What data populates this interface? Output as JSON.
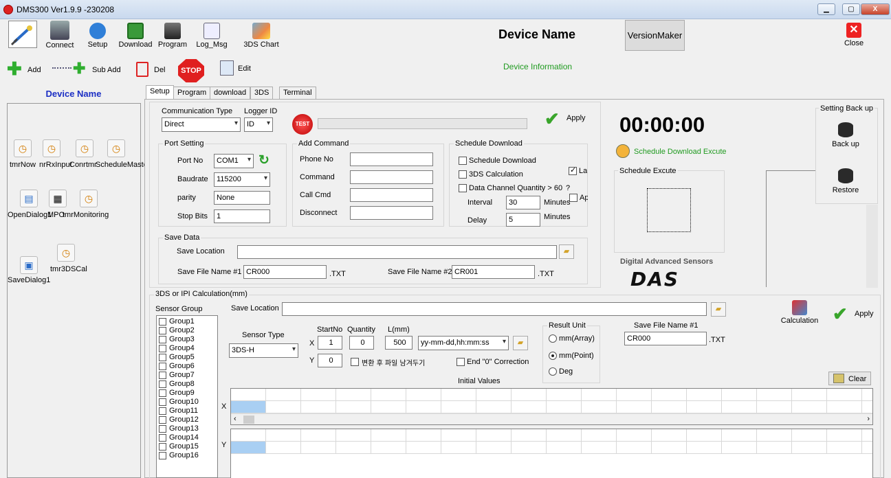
{
  "window": {
    "title": "DMS300 Ver1.9.9 -230208",
    "minimize": "▁",
    "maximize": "▢",
    "close": "X"
  },
  "toolbar": {
    "connect": "Connect",
    "setup": "Setup",
    "download": "Download",
    "program": "Program",
    "log_msg": "Log_Msg",
    "chart_3ds": "3DS Chart",
    "close": "Close",
    "add": "Add",
    "sub_add": "Sub Add",
    "del": "Del",
    "edit": "Edit"
  },
  "header": {
    "device_name": "Device Name",
    "version_maker": "VersionMaker",
    "device_info": "Device Information"
  },
  "left_panel": {
    "title": "Device Name",
    "components": [
      {
        "label": "tmrNow"
      },
      {
        "label": "nrRxInput"
      },
      {
        "label": "Conrtmr"
      },
      {
        "label": "ScheduleMaster"
      },
      {
        "label": "OpenDialog1"
      },
      {
        "label": "MPO"
      },
      {
        "label": "tmrMonitoring"
      },
      {
        "label": "SaveDialog1"
      },
      {
        "label": "tmr3DSCal"
      }
    ]
  },
  "tabs": [
    "Setup",
    "Program",
    "download",
    "3DS",
    "Terminal"
  ],
  "setup": {
    "comm_type_label": "Communication Type",
    "comm_type_value": "Direct",
    "logger_id_label": "Logger ID",
    "logger_id_value": "ID",
    "test_label": "TEST",
    "apply": "Apply",
    "port": {
      "title": "Port Setting",
      "port_no_label": "Port No",
      "port_no_value": "COM1",
      "baud_label": "Baudrate",
      "baud_value": "115200",
      "parity_label": "parity",
      "parity_value": "None",
      "stopbits_label": "Stop Bits",
      "stopbits_value": "1"
    },
    "add_command": {
      "title": "Add Command",
      "phone_no": "Phone No",
      "command": "Command",
      "call_cmd": "Call Cmd",
      "disconnect": "Disconnect"
    },
    "schedule": {
      "title": "Schedule Download",
      "sched_dl": "Schedule Download",
      "calc_3ds": "3DS Calculation",
      "data_chan": "Data Channel Quantity > 60",
      "q": "?",
      "interval_label": "Interval",
      "interval_value": "30",
      "interval_unit": "Minutes",
      "delay_label": "Delay",
      "delay_value": "5",
      "delay_unit": "Minutes",
      "las": "Las",
      "ap": "Ap"
    },
    "save_data": {
      "title": "Save Data",
      "location_label": "Save Location",
      "file1_label": "Save File Name #1",
      "file1_value": "CR000",
      "ext1": ".TXT",
      "file2_label": "Save File Name #2",
      "file2_value": "CR001",
      "ext2": ".TXT"
    }
  },
  "right_panel": {
    "clock": "00:00:00",
    "sched_exec_link": "Schedule Download Excute",
    "sched_exec_title": "Schedule Excute",
    "brand": "Digital Advanced Sensors",
    "logo": "DAS",
    "backup_group": "Setting Back up",
    "backup": "Back up",
    "restore": "Restore"
  },
  "calc": {
    "title": "3DS or IPI Calculation(mm)",
    "sensor_group_label": "Sensor Group",
    "groups": [
      "Group1",
      "Group2",
      "Group3",
      "Group4",
      "Group5",
      "Group6",
      "Group7",
      "Group8",
      "Group9",
      "Group10",
      "Group11",
      "Group12",
      "Group13",
      "Group14",
      "Group15",
      "Group16"
    ],
    "save_location_label": "Save Location",
    "calculation": "Calculation",
    "apply": "Apply",
    "sensor_type_label": "Sensor Type",
    "sensor_type_value": "3DS-H",
    "startno": "StartNo",
    "quantity": "Quantity",
    "length": "L(mm)",
    "x_label": "X",
    "y_label": "Y",
    "x_start": "1",
    "x_qty": "0",
    "x_len": "500",
    "y_start": "0",
    "date_fmt": "yy-mm-dd,hh:mm:ss",
    "keep_file": "변환 후 파일 남겨두기",
    "end_correction": "End \"0\" Correction",
    "result_unit": "Result Unit",
    "mm_array": "mm(Array)",
    "mm_point": "mm(Point)",
    "deg": "Deg",
    "save_file_label": "Save File Name #1",
    "save_file_value": "CR000",
    "ext": ".TXT",
    "initial_values": "Initial Values",
    "clear": "Clear",
    "grid_x": "X",
    "grid_y": "Y"
  }
}
